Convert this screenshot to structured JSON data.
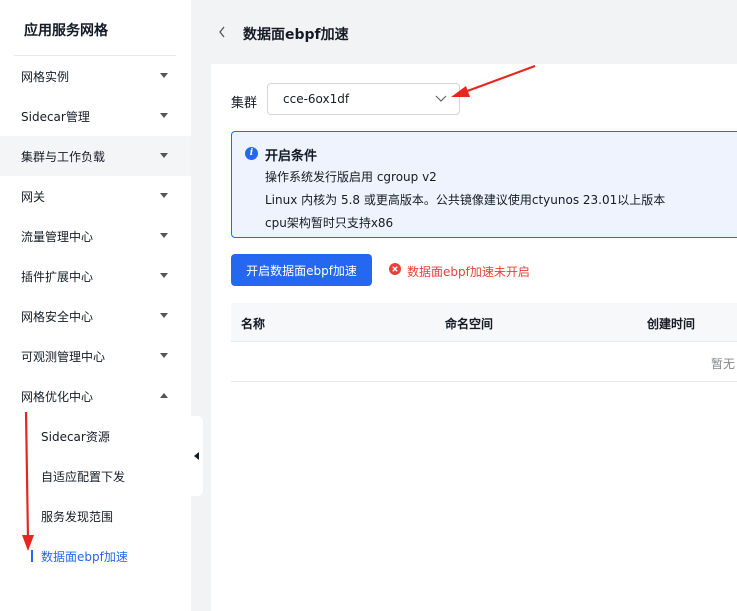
{
  "sidebar": {
    "title": "应用服务网格",
    "items": [
      {
        "label": "网格实例"
      },
      {
        "label": "Sidecar管理"
      },
      {
        "label": "集群与工作负载"
      },
      {
        "label": "网关"
      },
      {
        "label": "流量管理中心"
      },
      {
        "label": "插件扩展中心"
      },
      {
        "label": "网格安全中心"
      },
      {
        "label": "可观测管理中心"
      },
      {
        "label": "网格优化中心"
      }
    ],
    "sub_items": [
      {
        "label": "Sidecar资源"
      },
      {
        "label": "自适应配置下发"
      },
      {
        "label": "服务发现范围"
      },
      {
        "label": "数据面ebpf加速"
      }
    ],
    "accent": "#2468f2"
  },
  "header": {
    "title": "数据面ebpf加速"
  },
  "cluster": {
    "label": "集群",
    "value": "cce-6ox1df"
  },
  "info": {
    "title": "开启条件",
    "lines": [
      "操作系统发行版启用 cgroup v2",
      "Linux 内核为 5.8 或更高版本。公共镜像建议使用ctyunos 23.01以上版本",
      "cpu架构暂时只支持x86"
    ]
  },
  "enable_button": {
    "label": "开启数据面ebpf加速"
  },
  "status": {
    "text": "数据面ebpf加速未开启",
    "color": "#e8403a"
  },
  "table": {
    "columns": [
      "名称",
      "命名空间",
      "创建时间"
    ],
    "empty_text": "暂无"
  }
}
